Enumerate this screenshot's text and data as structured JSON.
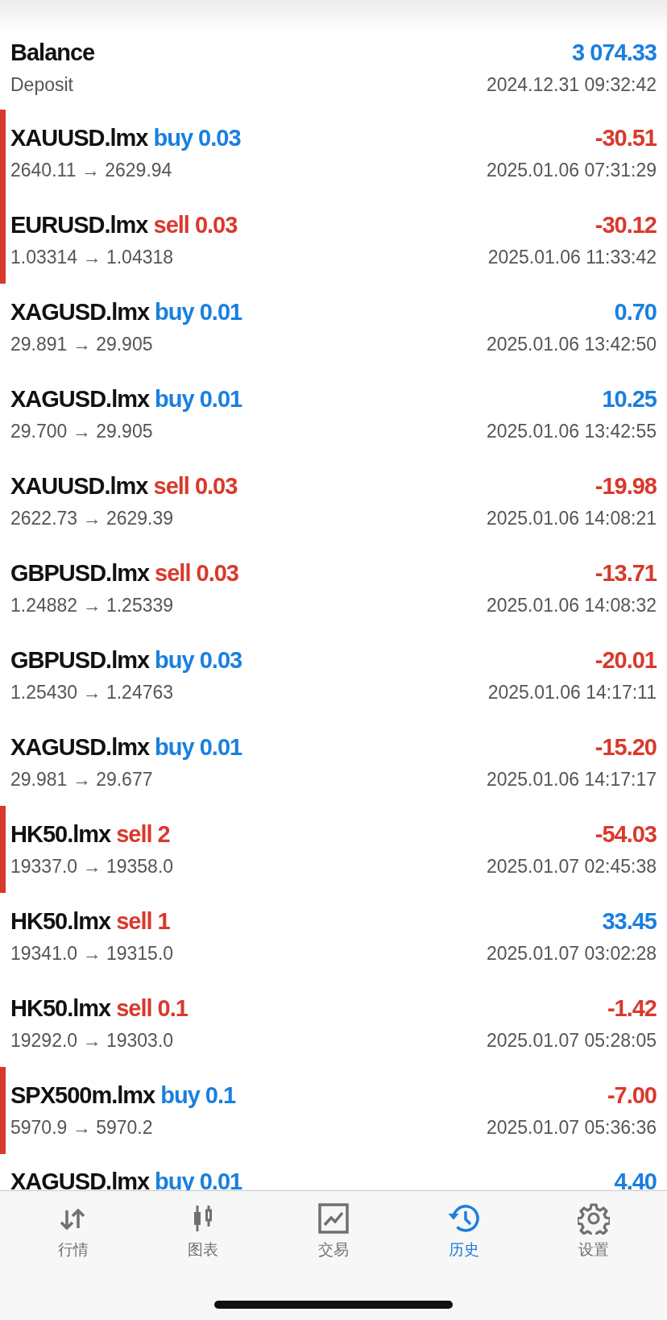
{
  "balance": {
    "label": "Balance",
    "amount": "3 074.33",
    "type": "Deposit",
    "time": "2024.12.31 09:32:42"
  },
  "deals": [
    {
      "symbol": "XAUUSD.lmx",
      "kind": "buy",
      "volume": "buy 0.03",
      "profit": "-30.51",
      "loss": true,
      "flagged": true,
      "prices": "2640.11 → 2629.94",
      "time": "2025.01.06 07:31:29"
    },
    {
      "symbol": "EURUSD.lmx",
      "kind": "sell",
      "volume": "sell 0.03",
      "profit": "-30.12",
      "loss": true,
      "flagged": true,
      "prices": "1.03314 → 1.04318",
      "time": "2025.01.06 11:33:42"
    },
    {
      "symbol": "XAGUSD.lmx",
      "kind": "buy",
      "volume": "buy 0.01",
      "profit": "0.70",
      "loss": false,
      "flagged": false,
      "prices": "29.891 → 29.905",
      "time": "2025.01.06 13:42:50"
    },
    {
      "symbol": "XAGUSD.lmx",
      "kind": "buy",
      "volume": "buy 0.01",
      "profit": "10.25",
      "loss": false,
      "flagged": false,
      "prices": "29.700 → 29.905",
      "time": "2025.01.06 13:42:55"
    },
    {
      "symbol": "XAUUSD.lmx",
      "kind": "sell",
      "volume": "sell 0.03",
      "profit": "-19.98",
      "loss": true,
      "flagged": false,
      "prices": "2622.73 → 2629.39",
      "time": "2025.01.06 14:08:21"
    },
    {
      "symbol": "GBPUSD.lmx",
      "kind": "sell",
      "volume": "sell 0.03",
      "profit": "-13.71",
      "loss": true,
      "flagged": false,
      "prices": "1.24882 → 1.25339",
      "time": "2025.01.06 14:08:32"
    },
    {
      "symbol": "GBPUSD.lmx",
      "kind": "buy",
      "volume": "buy 0.03",
      "profit": "-20.01",
      "loss": true,
      "flagged": false,
      "prices": "1.25430 → 1.24763",
      "time": "2025.01.06 14:17:11"
    },
    {
      "symbol": "XAGUSD.lmx",
      "kind": "buy",
      "volume": "buy 0.01",
      "profit": "-15.20",
      "loss": true,
      "flagged": false,
      "prices": "29.981 → 29.677",
      "time": "2025.01.06 14:17:17"
    },
    {
      "symbol": "HK50.lmx",
      "kind": "sell",
      "volume": "sell 2",
      "profit": "-54.03",
      "loss": true,
      "flagged": true,
      "prices": "19337.0 → 19358.0",
      "time": "2025.01.07 02:45:38"
    },
    {
      "symbol": "HK50.lmx",
      "kind": "sell",
      "volume": "sell 1",
      "profit": "33.45",
      "loss": false,
      "flagged": false,
      "prices": "19341.0 → 19315.0",
      "time": "2025.01.07 03:02:28"
    },
    {
      "symbol": "HK50.lmx",
      "kind": "sell",
      "volume": "sell 0.1",
      "profit": "-1.42",
      "loss": true,
      "flagged": false,
      "prices": "19292.0 → 19303.0",
      "time": "2025.01.07 05:28:05"
    },
    {
      "symbol": "SPX500m.lmx",
      "kind": "buy",
      "volume": "buy 0.1",
      "profit": "-7.00",
      "loss": true,
      "flagged": true,
      "prices": "5970.9 → 5970.2",
      "time": "2025.01.07 05:36:36"
    },
    {
      "symbol": "XAGUSD.lmx",
      "kind": "buy",
      "volume": "buy 0.01",
      "profit": "4.40",
      "loss": false,
      "flagged": false
    }
  ],
  "tabs": [
    {
      "kind": "quotes",
      "label": "行情",
      "selected": false
    },
    {
      "kind": "chart",
      "label": "图表",
      "selected": false
    },
    {
      "kind": "trade",
      "label": "交易",
      "selected": false
    },
    {
      "kind": "history",
      "label": "历史",
      "selected": true
    },
    {
      "kind": "settings",
      "label": "设置",
      "selected": false
    }
  ]
}
